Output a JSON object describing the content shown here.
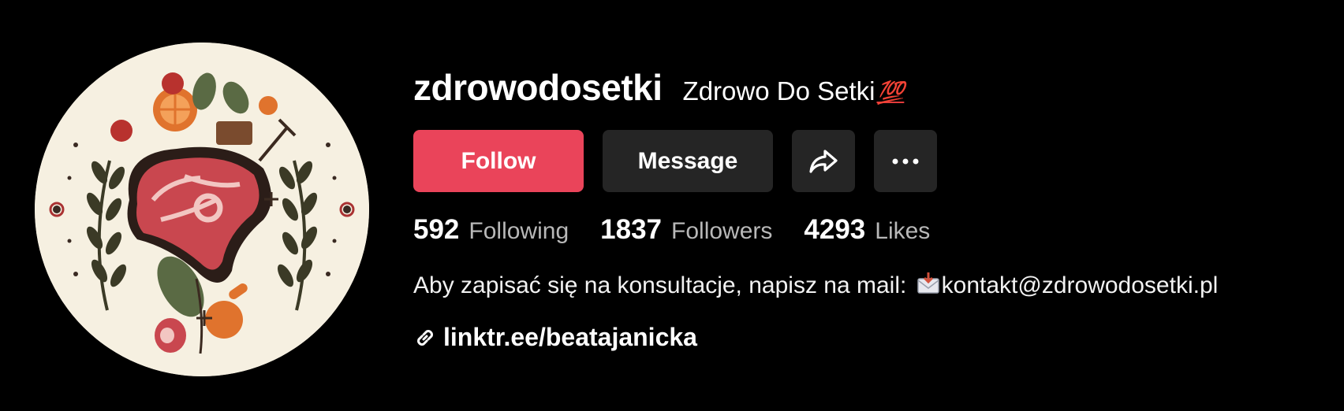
{
  "profile": {
    "username": "zdrowodosetki",
    "nickname": "Zdrowo Do Setki",
    "nickname_emoji": "💯"
  },
  "actions": {
    "follow_label": "Follow",
    "message_label": "Message",
    "share_icon": "share-arrow-icon",
    "more_icon": "more-dots-icon"
  },
  "stats": {
    "following_count": "592",
    "following_label": "Following",
    "followers_count": "1837",
    "followers_label": "Followers",
    "likes_count": "4293",
    "likes_label": "Likes"
  },
  "bio": {
    "text": "Aby zapisać się na konsultacje, napisz na mail: ",
    "email": "kontakt@zdrowodosetki.pl",
    "mail_icon": "incoming-envelope-icon"
  },
  "link": {
    "icon": "link-icon",
    "url_text": "linktr.ee/beatajanicka"
  },
  "colors": {
    "background": "#000000",
    "follow_button": "#ea445a",
    "secondary_button": "#252525",
    "label_gray": "#b8b8b8",
    "avatar_bg": "#f6f0e1"
  }
}
